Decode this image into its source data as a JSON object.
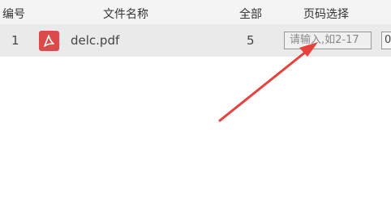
{
  "header": {
    "col_num": "编号",
    "col_filename": "文件名称",
    "col_total": "全部",
    "col_page_select": "页码选择"
  },
  "rows": [
    {
      "num": "1",
      "icon": "pdf-icon",
      "filename": "delc.pdf",
      "total": "5",
      "page_input_placeholder": "请输入,如2-17",
      "next_cell": "0"
    }
  ],
  "annotation": {
    "arrow_color": "#e8413c"
  },
  "colors": {
    "header_bg": "#f4f4f4",
    "row_bg": "#eaeaea",
    "pdf_icon_bg": "#d94a49"
  }
}
